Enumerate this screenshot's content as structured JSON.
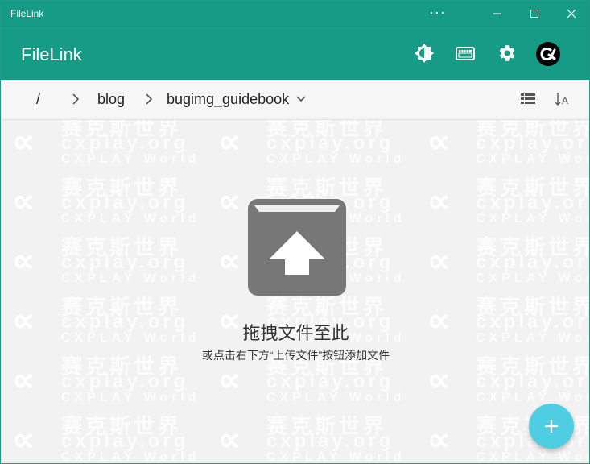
{
  "window": {
    "title": "FileLink",
    "more_label": "···"
  },
  "appbar": {
    "app_name": "FileLink",
    "icons": [
      "theme-toggle-icon",
      "keyboard-icon",
      "gear-icon",
      "cxplay-logo-icon"
    ]
  },
  "breadcrumb": {
    "root": "/",
    "items": [
      "blog",
      "bugimg_guidebook"
    ]
  },
  "toolbar": {
    "icons": [
      "list-view-icon",
      "sort-icon"
    ]
  },
  "empty_state": {
    "title": "拖拽文件至此",
    "hint": "或点击右下方“上传文件”按钮添加文件"
  },
  "watermark": {
    "lines": [
      "赛克斯世界",
      "cxplay.org",
      "CXPLAY World"
    ]
  },
  "colors": {
    "accent": "#169b86",
    "fab": "#4fcde3",
    "background": "#f2f2f2"
  }
}
